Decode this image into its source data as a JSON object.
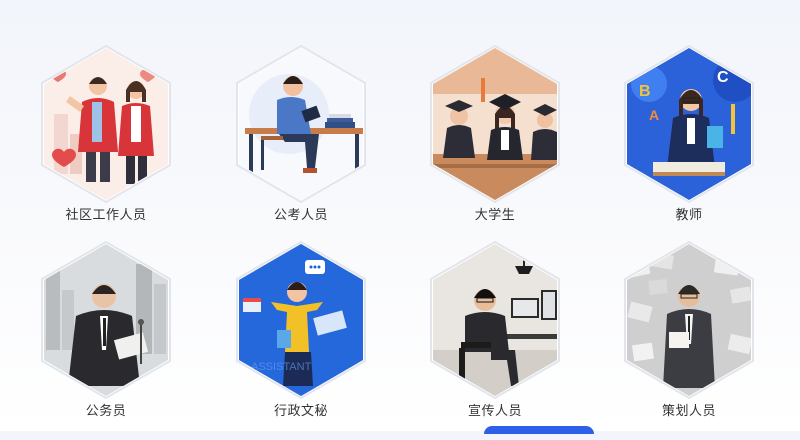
{
  "roles": [
    {
      "label": "社区工作人员",
      "icon": "community-workers-illustration"
    },
    {
      "label": "公考人员",
      "icon": "exam-candidate-illustration"
    },
    {
      "label": "大学生",
      "icon": "graduates-illustration"
    },
    {
      "label": "教师",
      "icon": "teacher-illustration"
    },
    {
      "label": "公务员",
      "icon": "civil-servant-illustration"
    },
    {
      "label": "行政文秘",
      "icon": "admin-secretary-illustration"
    },
    {
      "label": "宣传人员",
      "icon": "publicity-staff-illustration"
    },
    {
      "label": "策划人员",
      "icon": "planner-illustration"
    }
  ],
  "colors": {
    "accent": "#2e5fe8",
    "hex_border": "#e2e5ec",
    "label": "#333333"
  }
}
